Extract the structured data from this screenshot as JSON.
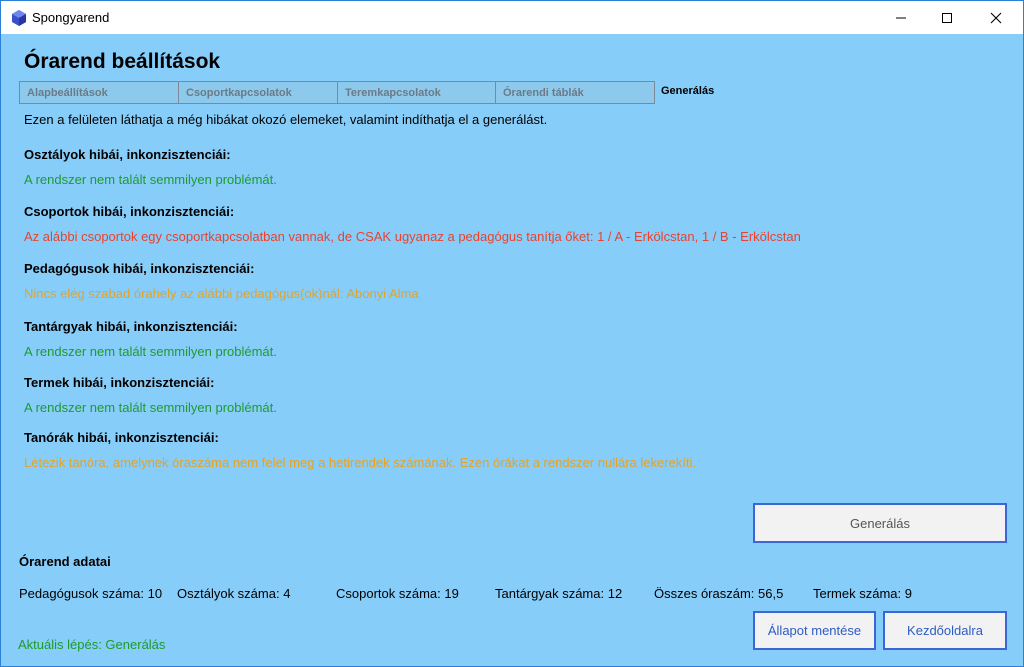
{
  "window": {
    "title": "Spongyarend",
    "icon": "app-cube-icon"
  },
  "page": {
    "title": "Órarend beállítások",
    "intro": "Ezen a felületen láthatja a még hibákat okozó elemeket, valamint indíthatja el a generálást."
  },
  "tabs": [
    {
      "label": "Alapbeállítások",
      "active": false
    },
    {
      "label": "Csoportkapcsolatok",
      "active": false
    },
    {
      "label": "Teremkapcsolatok",
      "active": false
    },
    {
      "label": "Órarendi táblák",
      "active": false
    },
    {
      "label": "Generálás",
      "active": true
    }
  ],
  "sections": [
    {
      "heading": "Osztályok hibái, inkonzisztenciái:",
      "message": "A rendszer nem talált semmilyen problémát.",
      "status": "ok"
    },
    {
      "heading": "Csoportok hibái, inkonzisztenciái:",
      "message": "Az alábbi csoportok egy csoportkapcsolatban vannak, de CSAK ugyanaz a pedagógus tanítja őket: 1 / A - Erkölcstan, 1 / B - Erkölcstan",
      "status": "error"
    },
    {
      "heading": "Pedagógusok hibái, inkonzisztenciái:",
      "message": "Nincs elég szabad órahely az alábbi pedagógus(ok)nál: Abonyi Alma",
      "status": "warning"
    },
    {
      "heading": "Tantárgyak hibái, inkonzisztenciái:",
      "message": "A rendszer nem talált semmilyen problémát.",
      "status": "ok"
    },
    {
      "heading": "Termek hibái, inkonzisztenciái:",
      "message": "A rendszer nem talált semmilyen problémát.",
      "status": "ok"
    },
    {
      "heading": "Tanórák hibái, inkonzisztenciái:",
      "message": "Létezik tanóra, amelynek óraszáma nem felel meg a hetirendek számának. Ezen órákat a rendszer nullára lekerekíti.",
      "status": "warning"
    }
  ],
  "buttons": {
    "generate": "Generálás",
    "save_state": "Állapot mentése",
    "home": "Kezdőoldalra"
  },
  "data": {
    "title": "Órarend adatai",
    "stats": [
      "Pedagógusok száma: 10",
      "Osztályok száma: 4",
      "Csoportok száma: 19",
      "Tantárgyak száma: 12",
      "Összes óraszám: 56,5",
      "Termek száma: 9"
    ]
  },
  "status": {
    "current_step": "Aktuális lépés: Generálás"
  },
  "colors": {
    "background": "#87cdf9",
    "ok": "#1f9a2e",
    "error": "#e7432f",
    "warning": "#e2a32a",
    "button_border": "#3b66d6"
  }
}
